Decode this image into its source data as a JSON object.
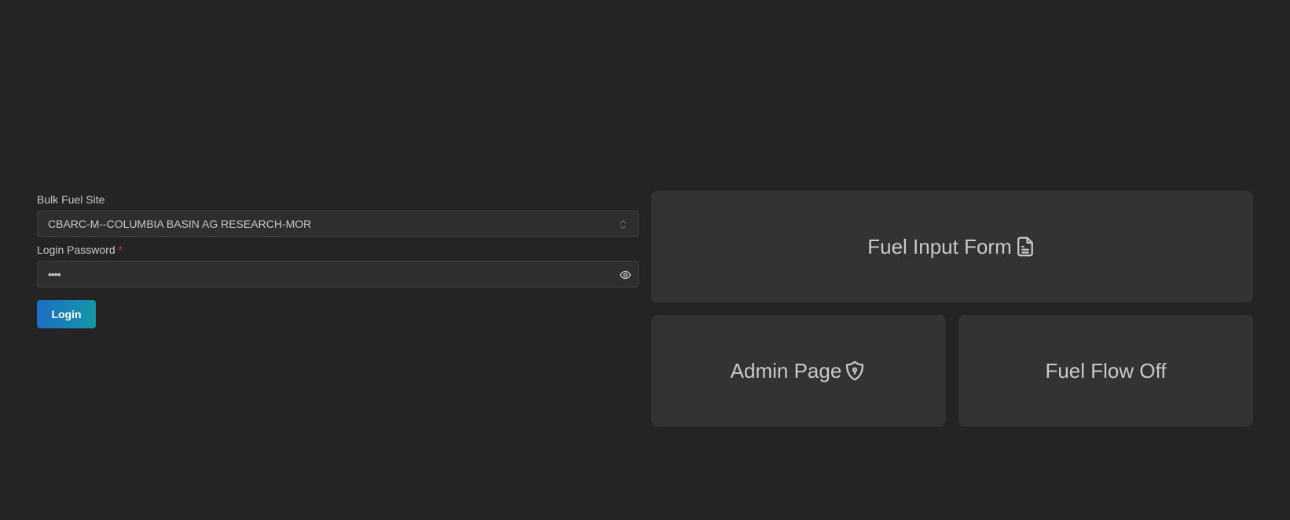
{
  "login": {
    "site_label": "Bulk Fuel Site",
    "site_value": "CBARC-M--COLUMBIA BASIN AG RESEARCH-MOR",
    "password_label": "Login Password",
    "required_mark": "*",
    "password_value": "••••",
    "login_button": "Login"
  },
  "tiles": {
    "fuel_input_form": "Fuel Input Form",
    "admin_page": "Admin Page",
    "fuel_flow_off": "Fuel Flow Off"
  },
  "icons": {
    "select": "chevron-selector-icon",
    "password_toggle": "eye-icon",
    "fuel_input_form": "file-text-icon",
    "admin_page": "shield-lock-icon"
  },
  "colors": {
    "background": "#242424",
    "tile": "#333333",
    "input": "#2e2e2e",
    "button_gradient_start": "#1c6fc2",
    "button_gradient_end": "#1597a6",
    "required": "#e03131"
  }
}
